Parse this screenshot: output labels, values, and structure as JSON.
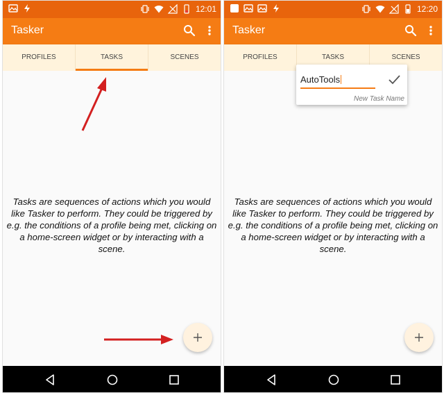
{
  "screens": [
    {
      "statusbar": {
        "time": "12:01"
      },
      "appbar": {
        "title": "Tasker"
      },
      "tabs": [
        {
          "label": "PROFILES",
          "active": false
        },
        {
          "label": "TASKS",
          "active": true
        },
        {
          "label": "SCENES",
          "active": false
        }
      ],
      "empty_message": "Tasks are sequences of actions which you would like Tasker to perform. They could be triggered by e.g. the conditions of a profile being met, clicking on a home-screen widget or by interacting with a scene.",
      "fab": {
        "icon": "plus-icon"
      },
      "annotations": [
        "red-arrow-to-tasks-tab",
        "red-arrow-to-add-button"
      ]
    },
    {
      "statusbar": {
        "time": "12:20"
      },
      "appbar": {
        "title": "Tasker"
      },
      "tabs": [
        {
          "label": "PROFILES",
          "active": false
        },
        {
          "label": "TASKS",
          "active": false
        },
        {
          "label": "SCENES",
          "active": false
        }
      ],
      "dialog": {
        "input_value": "AutoTools",
        "hint": "New Task Name",
        "confirm_icon": "check-icon"
      },
      "empty_message": "Tasks are sequences of actions which you would like Tasker to perform. They could be triggered by e.g. the conditions of a profile being met, clicking on a home-screen widget or by interacting with a scene.",
      "fab": {
        "icon": "plus-icon"
      }
    }
  ],
  "colors": {
    "statusbar": "#e8640c",
    "appbar": "#f57c14",
    "tabbar": "#fff3dc",
    "accent": "#f57c14",
    "annotation_arrow": "#d32020"
  }
}
